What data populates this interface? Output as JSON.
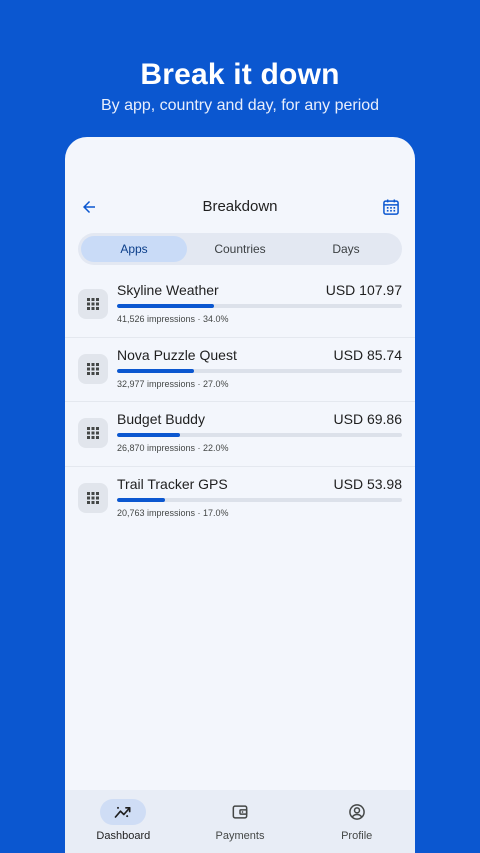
{
  "hero": {
    "title": "Break it down",
    "subtitle": "By app, country and day, for any period"
  },
  "appbar": {
    "title": "Breakdown",
    "back_icon": "arrow-back-icon",
    "calendar_icon": "calendar-icon"
  },
  "tabs": [
    {
      "label": "Apps",
      "active": true
    },
    {
      "label": "Countries",
      "active": false
    },
    {
      "label": "Days",
      "active": false
    }
  ],
  "rows": [
    {
      "name": "Skyline Weather",
      "amount": "USD 107.97",
      "meta": "41,526 impressions · 34.0%",
      "share": 0.34
    },
    {
      "name": "Nova Puzzle Quest",
      "amount": "USD 85.74",
      "meta": "32,977 impressions · 27.0%",
      "share": 0.27
    },
    {
      "name": "Budget Buddy",
      "amount": "USD 69.86",
      "meta": "26,870 impressions · 22.0%",
      "share": 0.22
    },
    {
      "name": "Trail Tracker GPS",
      "amount": "USD 53.98",
      "meta": "20,763 impressions · 17.0%",
      "share": 0.17
    }
  ],
  "nav": [
    {
      "label": "Dashboard",
      "icon": "trending-icon",
      "active": true
    },
    {
      "label": "Payments",
      "icon": "wallet-icon",
      "active": false
    },
    {
      "label": "Profile",
      "icon": "account-icon",
      "active": false
    }
  ],
  "colors": {
    "brand_blue": "#0B57D0",
    "surface": "#F3F6FC"
  }
}
